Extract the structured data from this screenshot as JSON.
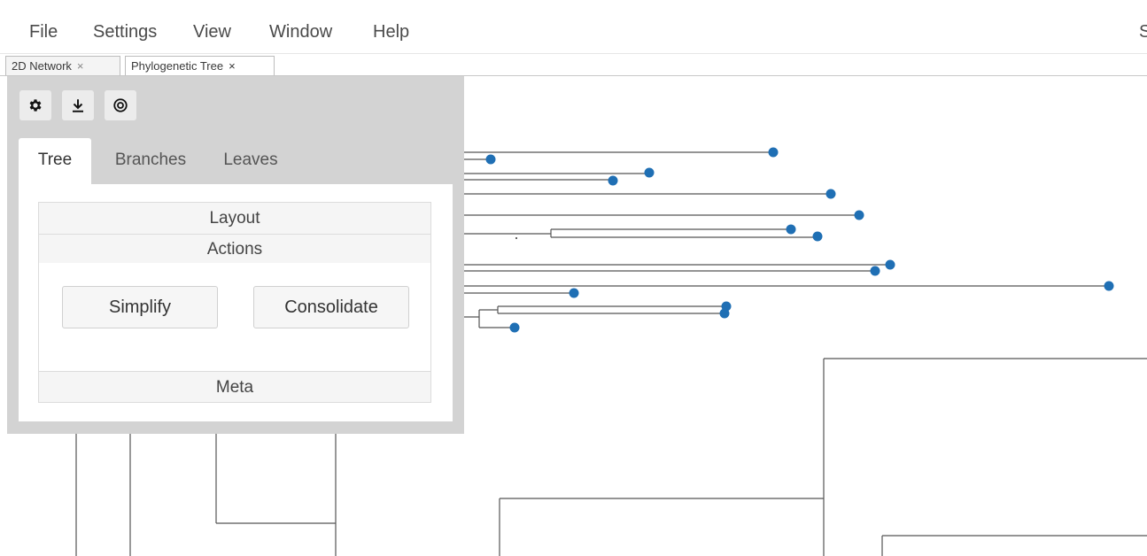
{
  "menu": {
    "items": [
      "File",
      "Settings",
      "View",
      "Window",
      "Help"
    ],
    "overflow": "S"
  },
  "doc_tabs": [
    {
      "label": "2D Network",
      "close": "×",
      "active": false
    },
    {
      "label": "Phylogenetic Tree",
      "close": "×",
      "active": true
    }
  ],
  "toolbar": {
    "icons": [
      "gear-icon",
      "download-icon",
      "target-icon"
    ]
  },
  "panel_tabs": [
    {
      "label": "Tree",
      "active": true
    },
    {
      "label": "Branches",
      "active": false
    },
    {
      "label": "Leaves",
      "active": false
    }
  ],
  "sections": {
    "layout": "Layout",
    "actions": "Actions",
    "meta": "Meta"
  },
  "actions": {
    "simplify": "Simplify",
    "consolidate": "Consolidate"
  },
  "colors": {
    "leaf_node": "#1f6fb4",
    "branch_line": "#555555",
    "panel_bg": "#d3d3d3"
  }
}
